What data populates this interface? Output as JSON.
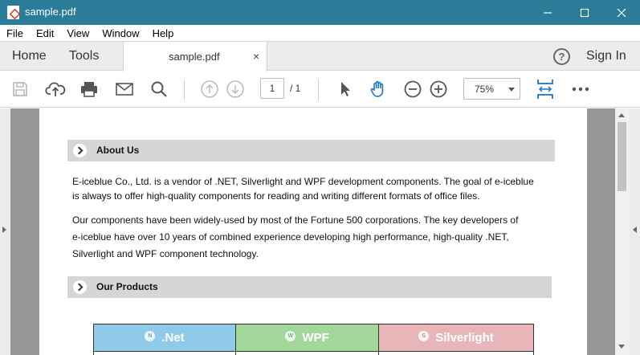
{
  "window": {
    "title": "sample.pdf"
  },
  "menu": {
    "items": [
      "File",
      "Edit",
      "View",
      "Window",
      "Help"
    ]
  },
  "tabs": {
    "home": "Home",
    "tools": "Tools",
    "document": "sample.pdf",
    "close": "×",
    "help": "?",
    "sign_in": "Sign In"
  },
  "toolbar": {
    "page_current": "1",
    "page_total": "/ 1",
    "zoom": "75%",
    "icons": [
      "save-icon",
      "upload-icon",
      "print-icon",
      "mail-icon",
      "search-icon",
      "page-up-icon",
      "page-down-icon",
      "select-arrow-icon",
      "hand-icon",
      "zoom-out-icon",
      "zoom-in-icon",
      "fit-width-icon",
      "more-icon"
    ],
    "accent_color": "#2b7c99"
  },
  "document": {
    "section1_title": "About Us",
    "section1_p1_line1": "E-iceblue Co., Ltd. is a vendor of .NET, Silverlight and WPF development components. The goal of e-iceblue",
    "section1_p1_line2": "is always to offer high-quality components for reading and writing different formats of office files.",
    "section1_p2_line1": "Our components have been widely-used by most of the Fortune 500 corporations. The key developers of",
    "section1_p2_line2": "e-iceblue have over 10 years of combined experience developing high performance, high-quality .NET,",
    "section1_p2_line3": "Silverlight and WPF component technology.",
    "section2_title": "Our Products",
    "products": [
      {
        "name": ".Net",
        "icon_letter": "N",
        "color": "#8fcbe8"
      },
      {
        "name": "WPF",
        "icon_letter": "W",
        "color": "#a2d99b"
      },
      {
        "name": "Silverlight",
        "icon_letter": "S",
        "color": "#e8b6b8"
      }
    ]
  }
}
